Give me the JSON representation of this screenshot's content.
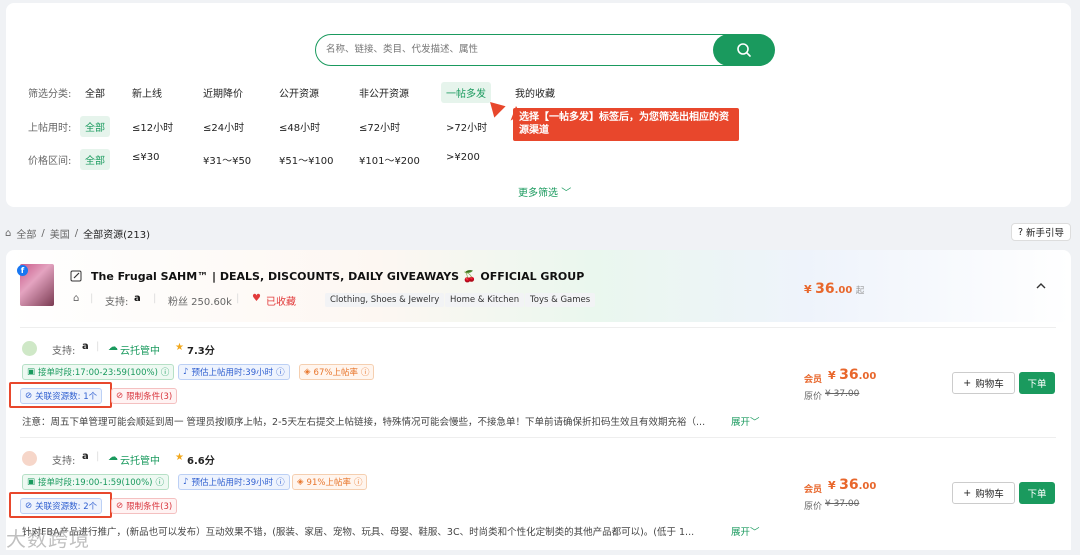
{
  "search": {
    "placeholder": "名称、链接、类目、代发描述、属性"
  },
  "filters": {
    "category": {
      "label": "筛选分类:",
      "options": [
        "全部",
        "新上线",
        "近期降价",
        "公开资源",
        "非公开资源",
        "一帖多发",
        "我的收藏"
      ]
    },
    "time": {
      "label": "上帖用时:",
      "options": [
        "全部",
        "≤12小时",
        "≤24小时",
        "≤48小时",
        "≤72小时",
        ">72小时"
      ]
    },
    "price": {
      "label": "价格区间:",
      "options": [
        "全部",
        "≤¥30",
        "¥31～¥50",
        "¥51～¥100",
        "¥101～¥200",
        ">¥200"
      ]
    },
    "more": "更多筛选"
  },
  "tooltip": "选择【一帖多发】标签后，为您筛选出相应的资源渠道",
  "breadcrumb": {
    "root": "全部",
    "country": "美国",
    "current": "全部资源(213)"
  },
  "guide_button": "新手引导",
  "group": {
    "title": "The Frugal SAHM™ | DEALS, DISCOUNTS, DAILY GIVEAWAYS 🍒 OFFICIAL GROUP",
    "support_label": "支持:",
    "support_icon": "amazon-icon",
    "followers": "粉丝 250.60k",
    "favorited": "已收藏",
    "tags": [
      "Clothing, Shoes & Jewelry",
      "Home & Kitchen",
      "Toys & Games"
    ],
    "price_currency": "¥",
    "price_int": "36",
    "price_dec": ".00",
    "price_suffix": "起"
  },
  "items": [
    {
      "support_label": "支持:",
      "hosting": "云托管中",
      "rating": "7.3分",
      "order_time": "接单时段:17:00-23:59(100%)",
      "post_time": "预估上帖用时:39小时",
      "post_rate": "67%上帖率",
      "linked": "关联资源数: 1个",
      "limit": "限制条件(3)",
      "note": "注意：周五下单管理可能会顺延到周一 管理员按顺序上帖，2-5天左右提交上帖链接，特殊情况可能会慢些，不接急单！下单前请确保折扣码生效且有效期充裕（...",
      "expand": "展开",
      "member_label": "会员",
      "price_currency": "¥",
      "price_int": "36",
      "price_dec": ".00",
      "orig_label": "原价",
      "orig_price": "¥ 37.00",
      "cart": "购物车",
      "order": "下单"
    },
    {
      "support_label": "支持:",
      "hosting": "云托管中",
      "rating": "6.6分",
      "order_time": "接单时段:19:00-1:59(100%)",
      "post_time": "预估上帖用时:39小时",
      "post_rate": "91%上帖率",
      "linked": "关联资源数: 2个",
      "limit": "限制条件(3)",
      "note": "针对FBA产品进行推广，(新品也可以发布）互动效果不错，(服装、家居、宠物、玩具、母婴、鞋服、3C、时尚类和个性化定制类的其他产品都可以)。(低于 1...",
      "expand": "展开",
      "member_label": "会员",
      "price_currency": "¥",
      "price_int": "36",
      "price_dec": ".00",
      "orig_label": "原价",
      "orig_price": "¥ 37.00",
      "cart": "购物车",
      "order": "下单"
    }
  ],
  "watermark": "大数跨境",
  "colors": {
    "accent": "#1a9a5e",
    "price": "#e8672c",
    "highlight": "#e8472c"
  }
}
